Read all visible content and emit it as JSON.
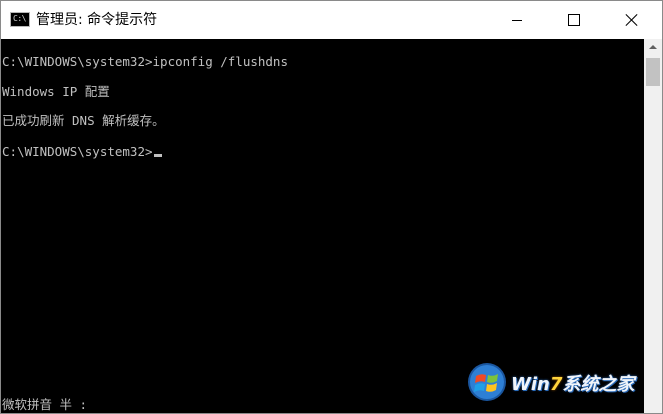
{
  "window": {
    "title": "管理员: 命令提示符",
    "icon": "cmd-icon",
    "icon_text": "C:\\",
    "buttons": {
      "minimize": "minimize-icon",
      "maximize": "maximize-icon",
      "close": "close-icon"
    }
  },
  "console": {
    "lines": [
      "C:\\WINDOWS\\system32>ipconfig /flushdns",
      "Windows IP 配置",
      "已成功刷新 DNS 解析缓存。",
      "C:\\WINDOWS\\system32>"
    ],
    "ime_status": "微软拼音 半 :",
    "colors": {
      "background": "#000000",
      "text": "#c0c0c0"
    }
  },
  "watermark": {
    "text_prefix": "Win",
    "text_accent": "7",
    "text_suffix": "系统之家"
  }
}
